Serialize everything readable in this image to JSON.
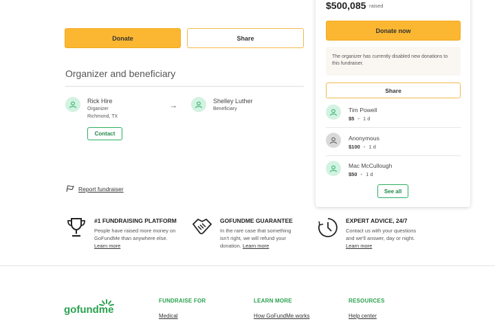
{
  "actions": {
    "donate_label": "Donate",
    "share_label": "Share"
  },
  "organizer_section": {
    "title": "Organizer and beneficiary",
    "organizer": {
      "name": "Rick Hire",
      "role": "Organizer",
      "location": "Richmond, TX",
      "contact_label": "Contact"
    },
    "beneficiary": {
      "name": "Shelley Luther",
      "role": "Beneficiary"
    }
  },
  "report": {
    "label": "Report fundraiser"
  },
  "features": [
    {
      "title": "#1 FUNDRAISING PLATFORM",
      "text": "People have raised more money on GoFundMe than anywhere else.",
      "link": "Learn more"
    },
    {
      "title": "GOFUNDME GUARANTEE",
      "text": "In the rare case that something isn't right, we will refund your donation.",
      "link": "Learn more"
    },
    {
      "title": "EXPERT ADVICE, 24/7",
      "text": "Contact us with your questions and we'll answer, day or night.",
      "link": "Learn more"
    }
  ],
  "footer": {
    "logo_text": "gofundme",
    "columns": [
      {
        "heading": "FUNDRAISE FOR",
        "links": [
          "Medical"
        ]
      },
      {
        "heading": "LEARN MORE",
        "links": [
          "How GoFundMe works"
        ]
      },
      {
        "heading": "RESOURCES",
        "links": [
          "Help center"
        ]
      }
    ]
  },
  "sidebar": {
    "raised_amount": "$500,085",
    "raised_label": "raised",
    "donate_now_label": "Donate now",
    "notice": "The organizer has currently disabled new donations to this fundraiser.",
    "share_label": "Share",
    "donations": [
      {
        "name": "Tim Powell",
        "amount": "$5",
        "time": "1 d",
        "anonymous": false
      },
      {
        "name": "Anonymous",
        "amount": "$100",
        "time": "1 d",
        "anonymous": true
      },
      {
        "name": "Mac McCullough",
        "amount": "$50",
        "time": "1 d",
        "anonymous": false
      }
    ],
    "see_all_label": "See all"
  },
  "colors": {
    "brand_green": "#2aa24f",
    "donate_yellow": "#fbb731",
    "avatar_green": "#d2f2e2"
  },
  "icons": [
    "user-icon",
    "arrow-right-icon",
    "flag-icon",
    "trophy-icon",
    "handshake-icon",
    "clock-icon"
  ]
}
